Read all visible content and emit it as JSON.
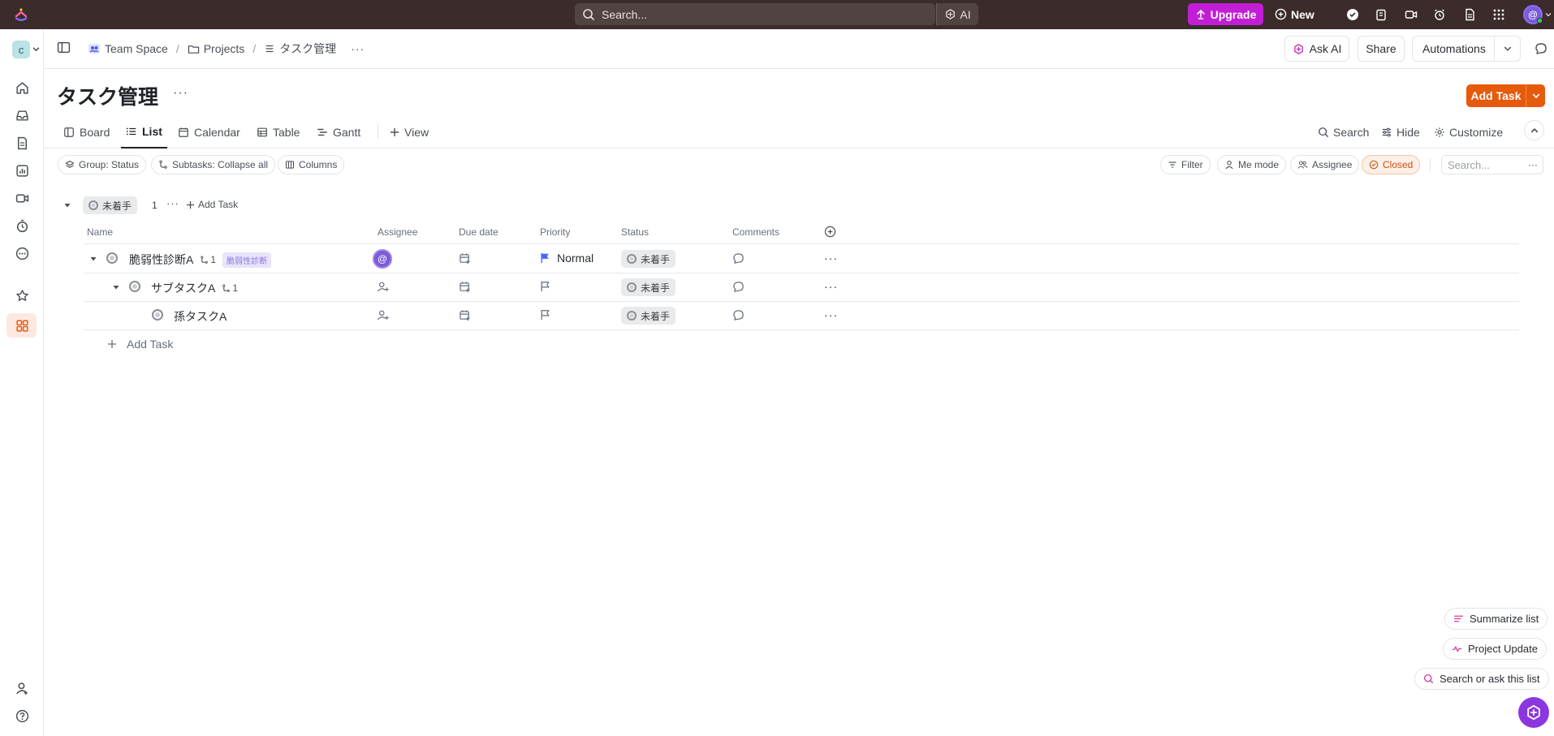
{
  "topbar": {
    "search_placeholder": "Search...",
    "ai_label": "AI",
    "upgrade_label": "Upgrade",
    "new_label": "New",
    "avatar_initial": "@",
    "icons": [
      "check-circle-icon",
      "clipboard-icon",
      "video-icon",
      "alarm-icon",
      "document-icon",
      "apps-grid-icon"
    ]
  },
  "rail": {
    "workspace_initial": "c",
    "items": [
      "home-icon",
      "inbox-icon",
      "docs-icon",
      "dashboard-icon",
      "clips-icon",
      "timesheet-icon",
      "more-icon",
      "favorites-icon",
      "spaces-icon"
    ],
    "bottom": [
      "invite-user-icon",
      "help-icon"
    ]
  },
  "header": {
    "breadcrumb": [
      {
        "label": "Team Space",
        "icon": "team-icon"
      },
      {
        "label": "Projects",
        "icon": "folder-icon"
      },
      {
        "label": "タスク管理",
        "icon": "list-icon"
      }
    ],
    "ask_ai_label": "Ask AI",
    "share_label": "Share",
    "automations_label": "Automations"
  },
  "page": {
    "title": "タスク管理",
    "add_task_label": "Add Task"
  },
  "tabs": [
    {
      "label": "Board",
      "icon": "board-icon",
      "active": false
    },
    {
      "label": "List",
      "icon": "list-icon",
      "active": true
    },
    {
      "label": "Calendar",
      "icon": "calendar-icon",
      "active": false
    },
    {
      "label": "Table",
      "icon": "table-icon",
      "active": false
    },
    {
      "label": "Gantt",
      "icon": "gantt-icon",
      "active": false
    }
  ],
  "add_view_label": "View",
  "tools": {
    "search": "Search",
    "hide": "Hide",
    "customize": "Customize"
  },
  "filters": {
    "group": "Group: Status",
    "subtasks": "Subtasks: Collapse all",
    "columns": "Columns",
    "filter": "Filter",
    "me_mode": "Me mode",
    "assignee": "Assignee",
    "closed": "Closed",
    "search_placeholder": "Search..."
  },
  "group": {
    "status": "未着手",
    "count": "1",
    "add_task": "Add Task"
  },
  "columns": [
    "Name",
    "Assignee",
    "Due date",
    "Priority",
    "Status",
    "Comments"
  ],
  "tasks": [
    {
      "name": "脆弱性診断A",
      "subtask_count": "1",
      "tag": "脆弱性診断",
      "priority": "Normal",
      "status": "未着手",
      "level": 0,
      "assigned": true
    },
    {
      "name": "サブタスクA",
      "subtask_count": "1",
      "tag": "",
      "priority": "",
      "status": "未着手",
      "level": 1,
      "assigned": false
    },
    {
      "name": "孫タスクA",
      "subtask_count": "",
      "tag": "",
      "priority": "",
      "status": "未着手",
      "level": 2,
      "assigned": false
    }
  ],
  "add_task_row": "Add Task",
  "ai_actions": {
    "summarize": "Summarize list",
    "project_update": "Project Update",
    "ask": "Search or ask this list"
  },
  "colors": {
    "topbar": "#3b2b2b",
    "upgrade": "#c11ed6",
    "add_task": "#e65a0c",
    "priority_normal": "#4466ff"
  }
}
